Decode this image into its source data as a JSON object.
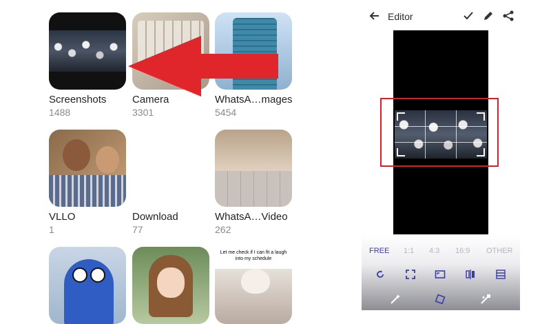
{
  "gallery": {
    "albums": [
      {
        "name": "Screenshots",
        "count": "1488"
      },
      {
        "name": "Camera",
        "count": "3301"
      },
      {
        "name": "WhatsA…mages",
        "count": "5454"
      },
      {
        "name": "VLLO",
        "count": "1"
      },
      {
        "name": "Download",
        "count": "77"
      },
      {
        "name": "WhatsA…Video",
        "count": "262"
      }
    ],
    "meme_caption": "Let me check if I can fit a laugh into my schedule"
  },
  "editor": {
    "title": "Editor",
    "icons": {
      "back": "arrow-left-icon",
      "confirm": "check-icon",
      "edit": "pencil-icon",
      "share": "share-icon"
    },
    "ratios": [
      {
        "label": "FREE",
        "active": true
      },
      {
        "label": "1:1",
        "active": false
      },
      {
        "label": "4:3",
        "active": false
      },
      {
        "label": "16:9",
        "active": false
      },
      {
        "label": "OTHER",
        "active": false
      }
    ],
    "tools_row1": [
      "rotate-icon",
      "fit-screen-icon",
      "crop-aspect-icon",
      "flip-icon",
      "crop-bars-icon"
    ],
    "tools_row2": [
      "magic-wand-icon",
      "straighten-icon",
      "auto-fix-icon"
    ]
  },
  "colors": {
    "accent": "#3a3aa8",
    "highlight": "#d61f26",
    "arrow": "#e1262b"
  }
}
